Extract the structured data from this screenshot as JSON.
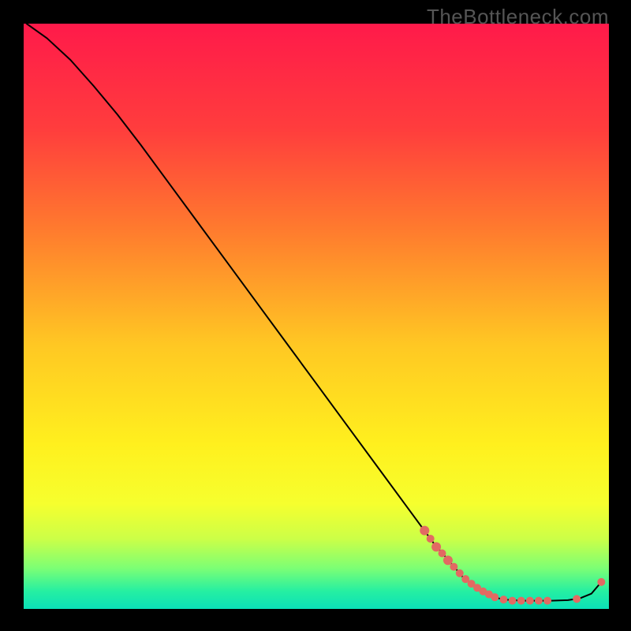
{
  "watermark": "TheBottleneck.com",
  "chart_data": {
    "type": "line",
    "title": "",
    "xlabel": "",
    "ylabel": "",
    "xlim": [
      0,
      100
    ],
    "ylim": [
      0,
      100
    ],
    "grid": false,
    "legend": false,
    "curve": [
      {
        "x": 0.5,
        "y": 100
      },
      {
        "x": 4,
        "y": 97.5
      },
      {
        "x": 8,
        "y": 93.8
      },
      {
        "x": 12,
        "y": 89.3
      },
      {
        "x": 16,
        "y": 84.5
      },
      {
        "x": 20,
        "y": 79.3
      },
      {
        "x": 25,
        "y": 72.5
      },
      {
        "x": 30,
        "y": 65.7
      },
      {
        "x": 35,
        "y": 58.9
      },
      {
        "x": 40,
        "y": 52.1
      },
      {
        "x": 45,
        "y": 45.3
      },
      {
        "x": 50,
        "y": 38.5
      },
      {
        "x": 55,
        "y": 31.7
      },
      {
        "x": 60,
        "y": 24.9
      },
      {
        "x": 65,
        "y": 18.1
      },
      {
        "x": 70,
        "y": 11.3
      },
      {
        "x": 75,
        "y": 5.5
      },
      {
        "x": 78,
        "y": 3.2
      },
      {
        "x": 80,
        "y": 2.1
      },
      {
        "x": 82,
        "y": 1.6
      },
      {
        "x": 85,
        "y": 1.4
      },
      {
        "x": 90,
        "y": 1.4
      },
      {
        "x": 93,
        "y": 1.5
      },
      {
        "x": 95,
        "y": 1.8
      },
      {
        "x": 97,
        "y": 2.6
      },
      {
        "x": 98.7,
        "y": 4.6
      }
    ],
    "highlight_dots": [
      {
        "x": 68.5,
        "y": 13.4,
        "r": 6
      },
      {
        "x": 69.5,
        "y": 12.0,
        "r": 5
      },
      {
        "x": 70.5,
        "y": 10.6,
        "r": 6
      },
      {
        "x": 71.5,
        "y": 9.5,
        "r": 5
      },
      {
        "x": 72.5,
        "y": 8.3,
        "r": 6
      },
      {
        "x": 73.5,
        "y": 7.2,
        "r": 5
      },
      {
        "x": 74.5,
        "y": 6.1,
        "r": 5
      },
      {
        "x": 75.5,
        "y": 5.1,
        "r": 5
      },
      {
        "x": 76.5,
        "y": 4.3,
        "r": 5
      },
      {
        "x": 77.5,
        "y": 3.6,
        "r": 5
      },
      {
        "x": 78.5,
        "y": 3.0,
        "r": 5
      },
      {
        "x": 79.5,
        "y": 2.5,
        "r": 5
      },
      {
        "x": 80.5,
        "y": 2.0,
        "r": 5
      },
      {
        "x": 82.0,
        "y": 1.6,
        "r": 5
      },
      {
        "x": 83.5,
        "y": 1.4,
        "r": 5
      },
      {
        "x": 85.0,
        "y": 1.4,
        "r": 5
      },
      {
        "x": 86.5,
        "y": 1.4,
        "r": 5
      },
      {
        "x": 88.0,
        "y": 1.4,
        "r": 5
      },
      {
        "x": 89.5,
        "y": 1.4,
        "r": 5
      },
      {
        "x": 94.5,
        "y": 1.7,
        "r": 5
      },
      {
        "x": 98.7,
        "y": 4.6,
        "r": 5
      }
    ],
    "gradient_stops": [
      {
        "offset": 0,
        "color": "#ff1a4a"
      },
      {
        "offset": 18,
        "color": "#ff3d3d"
      },
      {
        "offset": 35,
        "color": "#ff7a2e"
      },
      {
        "offset": 55,
        "color": "#ffc823"
      },
      {
        "offset": 72,
        "color": "#fff01e"
      },
      {
        "offset": 82,
        "color": "#f6ff2e"
      },
      {
        "offset": 88,
        "color": "#ccff47"
      },
      {
        "offset": 93,
        "color": "#7dff74"
      },
      {
        "offset": 97,
        "color": "#25efa2"
      },
      {
        "offset": 100,
        "color": "#0be0b8"
      }
    ],
    "dot_color": "#e26a62",
    "curve_color": "#000000"
  }
}
